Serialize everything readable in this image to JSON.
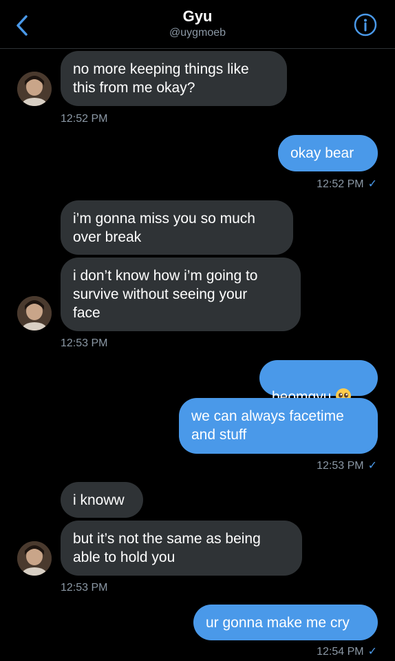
{
  "header": {
    "name": "Gyu",
    "handle": "@uygmoeb"
  },
  "icons": {
    "back": "chevron-left-icon",
    "info": "info-circle-icon",
    "read": "checkmark-icon",
    "emoji": "pleading-face-emoji"
  },
  "colors": {
    "background": "#000000",
    "received_bubble": "#2f3336",
    "sent_bubble": "#4a99e9",
    "timestamp": "#8b98a5",
    "accent": "#4a99e9"
  },
  "messages": [
    {
      "from": "them",
      "text": "no more keeping things like\nthis from me okay?"
    },
    {
      "from": "me",
      "text": "okay bear"
    },
    {
      "from": "them",
      "text": "i’m gonna miss you so much\nover break"
    },
    {
      "from": "them",
      "text": "i don’t know how i’m going to\nsurvive without seeing your\nface"
    },
    {
      "from": "me",
      "text": "beomgyu"
    },
    {
      "from": "me",
      "text": "we can always facetime\nand stuff"
    },
    {
      "from": "them",
      "text": "i knoww"
    },
    {
      "from": "them",
      "text": "but it’s not the same as being\nable to hold you"
    },
    {
      "from": "me",
      "text": "ur gonna make me cry"
    }
  ],
  "timestamps": [
    {
      "text": "12:52 PM",
      "read": false
    },
    {
      "text": "12:52 PM",
      "read": true,
      "mark": "✓"
    },
    {
      "text": "12:53 PM",
      "read": false
    },
    {
      "text": "12:53 PM",
      "read": true,
      "mark": "✓"
    },
    {
      "text": "12:53 PM",
      "read": false
    },
    {
      "text": "12:54 PM",
      "read": true,
      "mark": "✓"
    }
  ]
}
